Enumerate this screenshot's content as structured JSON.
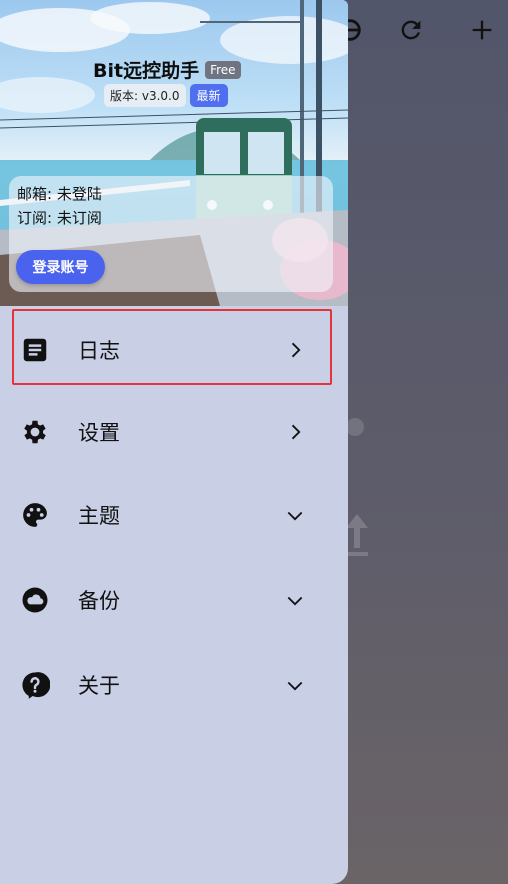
{
  "app": {
    "title": "Bit远控助手",
    "plan_tag": "Free",
    "version": "版本: v3.0.0",
    "latest_badge": "最新"
  },
  "account": {
    "email_line": "邮箱: 未登陆",
    "subscription_line": "订阅: 未订阅",
    "login_button": "登录账号"
  },
  "menu": {
    "items": [
      {
        "label": "日志",
        "icon": "log-icon",
        "indicator": "chevron-right"
      },
      {
        "label": "设置",
        "icon": "gear-icon",
        "indicator": "chevron-right"
      },
      {
        "label": "主题",
        "icon": "palette-icon",
        "indicator": "chevron-down"
      },
      {
        "label": "备份",
        "icon": "cloud-icon",
        "indicator": "chevron-down"
      },
      {
        "label": "关于",
        "icon": "help-icon",
        "indicator": "chevron-down"
      }
    ]
  },
  "background_toolbar": {
    "icons": [
      "partial-icon",
      "refresh-icon",
      "add-icon"
    ]
  },
  "colors": {
    "drawer_bg": "#c9d0e6",
    "accent": "#4a63ee",
    "highlight": "#e5333a"
  }
}
